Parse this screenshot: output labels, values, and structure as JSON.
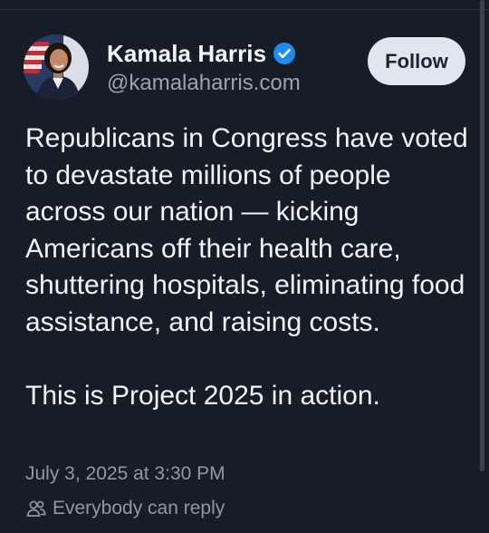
{
  "author": {
    "display_name": "Kamala Harris",
    "handle": "@kamalaharris.com",
    "verified": true,
    "avatar_icon": "profile-photo"
  },
  "follow_button": {
    "label": "Follow"
  },
  "post": {
    "paragraphs": [
      "Republicans in Congress have voted to devastate millions of people across our nation — kicking Americans off their health care, shuttering hospitals, eliminating food assistance, and raising costs.",
      "This is Project 2025 in action."
    ],
    "timestamp": "July 3, 2025 at 3:30 PM"
  },
  "reply_setting": {
    "icon": "people-icon",
    "label": "Everybody can reply"
  },
  "colors": {
    "background": "#171d26",
    "text": "#f2f4f7",
    "muted": "#8e98a5",
    "verified_badge": "#1d8cf0",
    "follow_bg": "#dfe6ed"
  }
}
